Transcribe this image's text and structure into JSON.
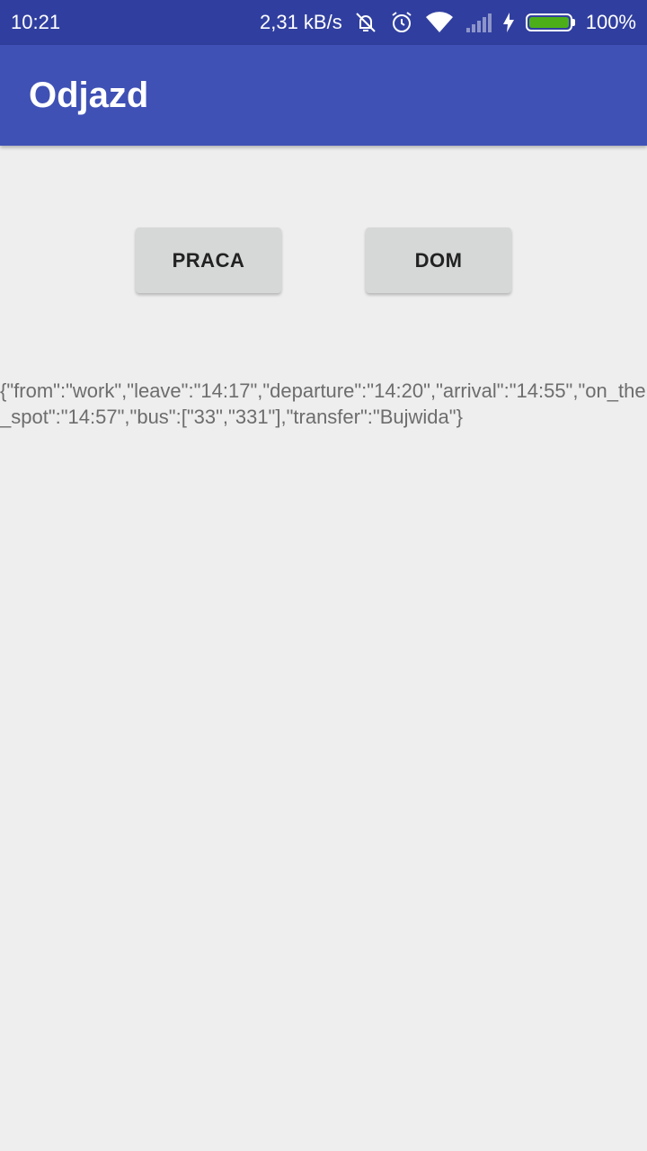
{
  "status_bar": {
    "time": "10:21",
    "net_speed": "2,31 kB/s",
    "battery_percent": "100%",
    "battery_level": 1.0,
    "icons": [
      "notifications-off-icon",
      "alarm-icon",
      "wifi-icon",
      "cell-signal-icon",
      "charging-bolt-icon",
      "battery-icon"
    ],
    "colors": {
      "background": "#303f9f",
      "battery_fill": "#4caf1a"
    }
  },
  "app_bar": {
    "title": "Odjazd",
    "color": "#3f51b5"
  },
  "buttons": {
    "praca_label": "PRACA",
    "dom_label": "DOM"
  },
  "result": {
    "text": "{\"from\":\"work\",\"leave\":\"14:17\",\"departure\":\"14:20\",\"arrival\":\"14:55\",\"on_the_spot\":\"14:57\",\"bus\":[\"33\",\"331\"],\"transfer\":\"Bujwida\"}"
  }
}
